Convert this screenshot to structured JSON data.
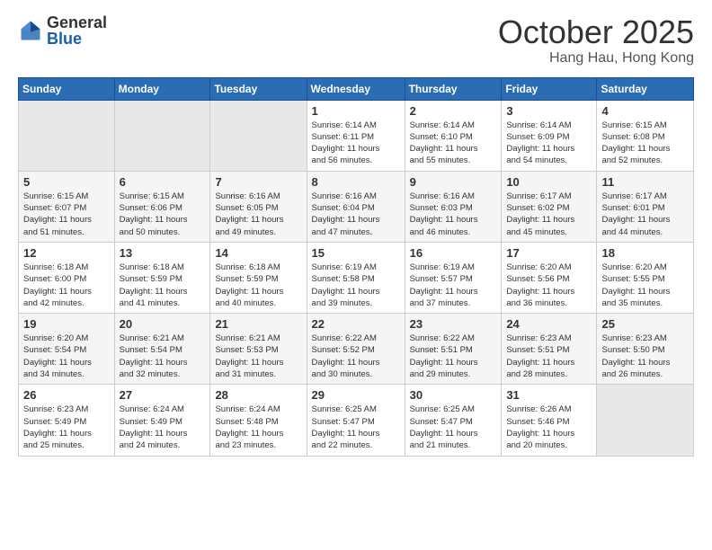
{
  "logo": {
    "general": "General",
    "blue": "Blue"
  },
  "header": {
    "month": "October 2025",
    "location": "Hang Hau, Hong Kong"
  },
  "weekdays": [
    "Sunday",
    "Monday",
    "Tuesday",
    "Wednesday",
    "Thursday",
    "Friday",
    "Saturday"
  ],
  "weeks": [
    [
      {
        "day": "",
        "info": ""
      },
      {
        "day": "",
        "info": ""
      },
      {
        "day": "",
        "info": ""
      },
      {
        "day": "1",
        "info": "Sunrise: 6:14 AM\nSunset: 6:11 PM\nDaylight: 11 hours\nand 56 minutes."
      },
      {
        "day": "2",
        "info": "Sunrise: 6:14 AM\nSunset: 6:10 PM\nDaylight: 11 hours\nand 55 minutes."
      },
      {
        "day": "3",
        "info": "Sunrise: 6:14 AM\nSunset: 6:09 PM\nDaylight: 11 hours\nand 54 minutes."
      },
      {
        "day": "4",
        "info": "Sunrise: 6:15 AM\nSunset: 6:08 PM\nDaylight: 11 hours\nand 52 minutes."
      }
    ],
    [
      {
        "day": "5",
        "info": "Sunrise: 6:15 AM\nSunset: 6:07 PM\nDaylight: 11 hours\nand 51 minutes."
      },
      {
        "day": "6",
        "info": "Sunrise: 6:15 AM\nSunset: 6:06 PM\nDaylight: 11 hours\nand 50 minutes."
      },
      {
        "day": "7",
        "info": "Sunrise: 6:16 AM\nSunset: 6:05 PM\nDaylight: 11 hours\nand 49 minutes."
      },
      {
        "day": "8",
        "info": "Sunrise: 6:16 AM\nSunset: 6:04 PM\nDaylight: 11 hours\nand 47 minutes."
      },
      {
        "day": "9",
        "info": "Sunrise: 6:16 AM\nSunset: 6:03 PM\nDaylight: 11 hours\nand 46 minutes."
      },
      {
        "day": "10",
        "info": "Sunrise: 6:17 AM\nSunset: 6:02 PM\nDaylight: 11 hours\nand 45 minutes."
      },
      {
        "day": "11",
        "info": "Sunrise: 6:17 AM\nSunset: 6:01 PM\nDaylight: 11 hours\nand 44 minutes."
      }
    ],
    [
      {
        "day": "12",
        "info": "Sunrise: 6:18 AM\nSunset: 6:00 PM\nDaylight: 11 hours\nand 42 minutes."
      },
      {
        "day": "13",
        "info": "Sunrise: 6:18 AM\nSunset: 5:59 PM\nDaylight: 11 hours\nand 41 minutes."
      },
      {
        "day": "14",
        "info": "Sunrise: 6:18 AM\nSunset: 5:59 PM\nDaylight: 11 hours\nand 40 minutes."
      },
      {
        "day": "15",
        "info": "Sunrise: 6:19 AM\nSunset: 5:58 PM\nDaylight: 11 hours\nand 39 minutes."
      },
      {
        "day": "16",
        "info": "Sunrise: 6:19 AM\nSunset: 5:57 PM\nDaylight: 11 hours\nand 37 minutes."
      },
      {
        "day": "17",
        "info": "Sunrise: 6:20 AM\nSunset: 5:56 PM\nDaylight: 11 hours\nand 36 minutes."
      },
      {
        "day": "18",
        "info": "Sunrise: 6:20 AM\nSunset: 5:55 PM\nDaylight: 11 hours\nand 35 minutes."
      }
    ],
    [
      {
        "day": "19",
        "info": "Sunrise: 6:20 AM\nSunset: 5:54 PM\nDaylight: 11 hours\nand 34 minutes."
      },
      {
        "day": "20",
        "info": "Sunrise: 6:21 AM\nSunset: 5:54 PM\nDaylight: 11 hours\nand 32 minutes."
      },
      {
        "day": "21",
        "info": "Sunrise: 6:21 AM\nSunset: 5:53 PM\nDaylight: 11 hours\nand 31 minutes."
      },
      {
        "day": "22",
        "info": "Sunrise: 6:22 AM\nSunset: 5:52 PM\nDaylight: 11 hours\nand 30 minutes."
      },
      {
        "day": "23",
        "info": "Sunrise: 6:22 AM\nSunset: 5:51 PM\nDaylight: 11 hours\nand 29 minutes."
      },
      {
        "day": "24",
        "info": "Sunrise: 6:23 AM\nSunset: 5:51 PM\nDaylight: 11 hours\nand 28 minutes."
      },
      {
        "day": "25",
        "info": "Sunrise: 6:23 AM\nSunset: 5:50 PM\nDaylight: 11 hours\nand 26 minutes."
      }
    ],
    [
      {
        "day": "26",
        "info": "Sunrise: 6:23 AM\nSunset: 5:49 PM\nDaylight: 11 hours\nand 25 minutes."
      },
      {
        "day": "27",
        "info": "Sunrise: 6:24 AM\nSunset: 5:49 PM\nDaylight: 11 hours\nand 24 minutes."
      },
      {
        "day": "28",
        "info": "Sunrise: 6:24 AM\nSunset: 5:48 PM\nDaylight: 11 hours\nand 23 minutes."
      },
      {
        "day": "29",
        "info": "Sunrise: 6:25 AM\nSunset: 5:47 PM\nDaylight: 11 hours\nand 22 minutes."
      },
      {
        "day": "30",
        "info": "Sunrise: 6:25 AM\nSunset: 5:47 PM\nDaylight: 11 hours\nand 21 minutes."
      },
      {
        "day": "31",
        "info": "Sunrise: 6:26 AM\nSunset: 5:46 PM\nDaylight: 11 hours\nand 20 minutes."
      },
      {
        "day": "",
        "info": ""
      }
    ]
  ]
}
